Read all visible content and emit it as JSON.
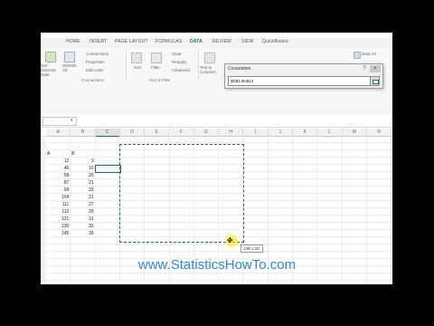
{
  "ribbon": {
    "tabs": [
      "HOME",
      "INSERT",
      "PAGE LAYOUT",
      "FORMULAS",
      "DATA",
      "REVIEW",
      "VIEW",
      "QuickBooks"
    ],
    "active_tab": "DATA",
    "get_external_data": "Get External Data",
    "connections_items": [
      "Connections",
      "Properties",
      "Edit Links"
    ],
    "refresh_all": "Refresh All",
    "connections_group": "Connections",
    "sort": "Sort",
    "filter": "Filter",
    "filter_items": [
      "Clear",
      "Reapply",
      "Advanced"
    ],
    "sort_filter_group": "Sort & Filter",
    "text_to_columns": "Text to Columns",
    "data_analysis": "Data An"
  },
  "dialog": {
    "title": "Covariation",
    "input_value": "$D$1:$H$13",
    "close_glyph": "×",
    "help_glyph": "?"
  },
  "grid": {
    "columns": [
      "A",
      "B",
      "C",
      "D",
      "E",
      "F",
      "G",
      "H",
      "I",
      "J",
      "K",
      "L",
      "M",
      "N"
    ],
    "selected_column": "C",
    "header_row": {
      "A": "A",
      "B": "B"
    },
    "col_a": [
      12,
      46,
      58,
      87,
      99,
      104,
      111,
      112,
      121,
      130,
      145
    ],
    "col_b": [
      3,
      10,
      20,
      21,
      33,
      21,
      27,
      29,
      31,
      33,
      39
    ],
    "size_tooltip": "13R x 5C"
  },
  "watermark": "www.StatisticsHowTo.com",
  "colors": {
    "accent": "#217346",
    "url": "#2e86d6",
    "selection": "#217346"
  }
}
